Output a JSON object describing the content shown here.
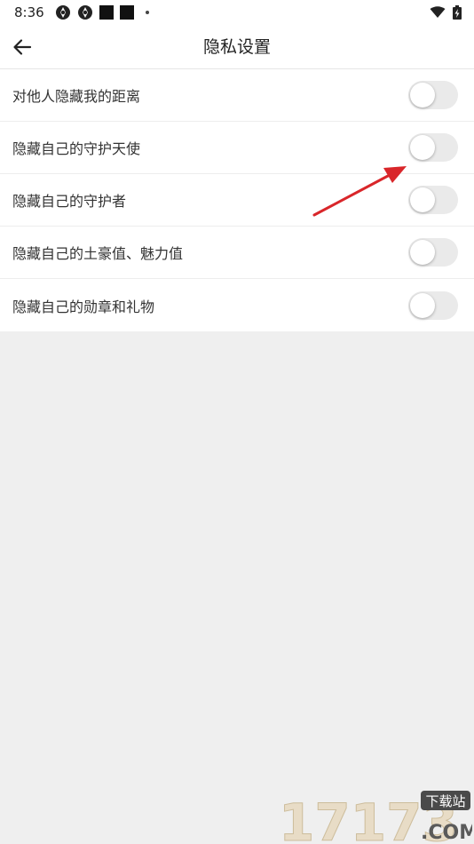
{
  "status_bar": {
    "time": "8:36"
  },
  "app_bar": {
    "title": "隐私设置",
    "back_icon": "arrow-left-icon"
  },
  "settings": [
    {
      "label": "对他人隐藏我的距离",
      "on": false
    },
    {
      "label": "隐藏自己的守护天使",
      "on": false
    },
    {
      "label": "隐藏自己的守护者",
      "on": false
    },
    {
      "label": "隐藏自己的土豪值、魅力值",
      "on": false
    },
    {
      "label": "隐藏自己的勋章和礼物",
      "on": false
    }
  ],
  "colors": {
    "toggle_off_track": "#eaeaea",
    "annotation_arrow": "#d9262a",
    "background": "#efefef"
  },
  "watermark": {
    "brand": "17173",
    "badge": "下载站",
    "suffix": ".COM"
  }
}
